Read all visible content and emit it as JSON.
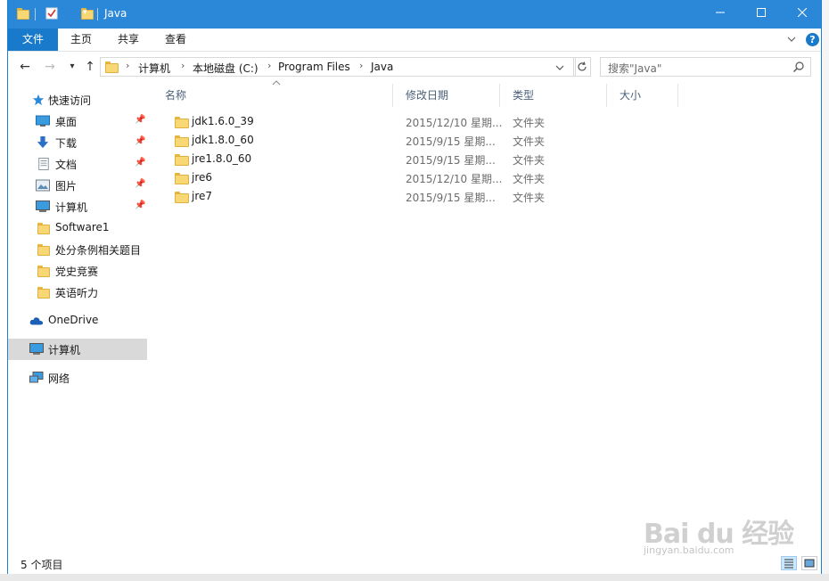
{
  "window": {
    "title": "Java"
  },
  "ribbon": {
    "tabs": [
      "文件",
      "主页",
      "共享",
      "查看"
    ],
    "help_label": "?"
  },
  "address": {
    "crumbs": [
      "计算机",
      "本地磁盘 (C:)",
      "Program Files",
      "Java"
    ]
  },
  "search": {
    "placeholder": "搜索\"Java\""
  },
  "nav": {
    "quick_access": "快速访问",
    "items": [
      {
        "label": "桌面",
        "icon": "desktop-icon",
        "pinned": true
      },
      {
        "label": "下载",
        "icon": "download-icon",
        "pinned": true
      },
      {
        "label": "文档",
        "icon": "document-icon",
        "pinned": true
      },
      {
        "label": "图片",
        "icon": "picture-icon",
        "pinned": true
      },
      {
        "label": "计算机",
        "icon": "computer-icon",
        "pinned": true
      },
      {
        "label": "Software1",
        "icon": "folder-icon",
        "pinned": false
      },
      {
        "label": "处分条例相关题目",
        "icon": "folder-icon",
        "pinned": false
      },
      {
        "label": "党史竞赛",
        "icon": "folder-icon",
        "pinned": false
      },
      {
        "label": "英语听力",
        "icon": "folder-icon",
        "pinned": false
      }
    ],
    "onedrive": "OneDrive",
    "computer": "计算机",
    "network": "网络"
  },
  "columns": {
    "name": "名称",
    "date": "修改日期",
    "type": "类型",
    "size": "大小"
  },
  "files": [
    {
      "name": "jdk1.6.0_39",
      "date": "2015/12/10 星期...",
      "type": "文件夹"
    },
    {
      "name": "jdk1.8.0_60",
      "date": "2015/9/15 星期...",
      "type": "文件夹"
    },
    {
      "name": "jre1.8.0_60",
      "date": "2015/9/15 星期...",
      "type": "文件夹"
    },
    {
      "name": "jre6",
      "date": "2015/12/10 星期...",
      "type": "文件夹"
    },
    {
      "name": "jre7",
      "date": "2015/9/15 星期...",
      "type": "文件夹"
    }
  ],
  "status": {
    "item_count": "5 个项目"
  },
  "watermark": {
    "brand": "Bai du 经验",
    "url": "jingyan.baidu.com"
  },
  "colors": {
    "titlebar": "#2b88d8",
    "file_tab": "#1979ca",
    "folder": "#f8d775",
    "selected": "#d9d9d9"
  }
}
